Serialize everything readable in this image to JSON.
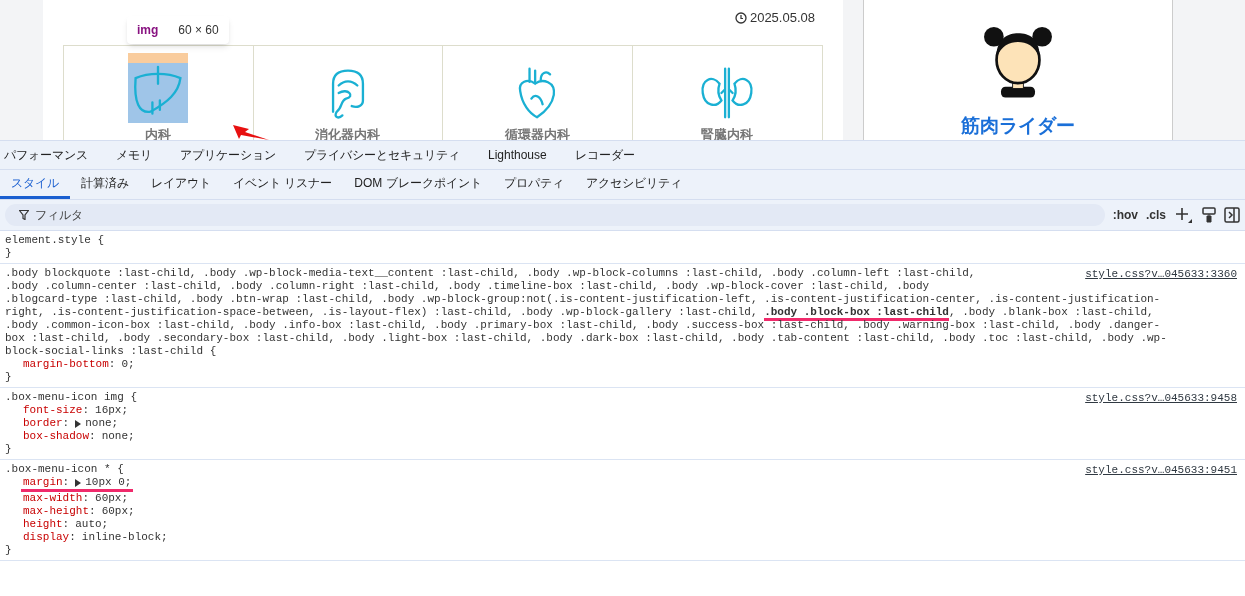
{
  "page": {
    "date": "2025.05.08",
    "tooltip": {
      "tag": "img",
      "size": "60 × 60"
    },
    "menu_items": [
      {
        "label": "内科",
        "kind": "liver",
        "highlighted": true
      },
      {
        "label": "消化器内科",
        "kind": "intestine",
        "highlighted": false
      },
      {
        "label": "循環器内科",
        "kind": "heart",
        "highlighted": false
      },
      {
        "label": "腎臓内科",
        "kind": "kidney",
        "highlighted": false
      }
    ],
    "profile": {
      "name": "筋肉ライダー"
    }
  },
  "devtools": {
    "panels": [
      "パフォーマンス",
      "メモリ",
      "アプリケーション",
      "プライバシーとセキュリティ",
      "Lighthouse",
      "レコーダー"
    ],
    "tabs": [
      {
        "label": "スタイル",
        "selected": true
      },
      {
        "label": "計算済み",
        "selected": false
      },
      {
        "label": "レイアウト",
        "selected": false
      },
      {
        "label": "イベント リスナー",
        "selected": false
      },
      {
        "label": "DOM ブレークポイント",
        "selected": false
      },
      {
        "label": "プロパティ",
        "selected": false
      },
      {
        "label": "アクセシビリティ",
        "selected": false
      }
    ],
    "filter": {
      "placeholder": "フィルタ"
    },
    "toolbar": {
      "hov": ":hov",
      "cls": ".cls"
    },
    "rules": [
      {
        "selector_lines": [
          "element.style {"
        ],
        "close": "}"
      },
      {
        "source": "style.css?v…045633:3360",
        "selector_lines": [
          ".body blockquote :last-child, .body .wp-block-media-text__content :last-child, .body .wp-block-columns :last-child, .body .column-left :last-child,",
          ".body .column-center :last-child, .body .column-right :last-child, .body .timeline-box :last-child, .body .wp-block-cover :last-child, .body",
          ".blogcard-type :last-child, .body .btn-wrap :last-child, .body .wp-block-group:not(.is-content-justification-left, .is-content-justification-center, .is-content-justification-",
          "right, .is-content-justification-space-between, .is-layout-flex) :last-child, .body .wp-block-gallery :last-child, **.body .block-box :last-child**, .body .blank-box :last-child,",
          ".body .common-icon-box :last-child, .body .info-box :last-child, .body .primary-box :last-child, .body .success-box :last-child, .body .warning-box :last-child, .body .danger-",
          "box :last-child, .body .secondary-box :last-child, .body .light-box :last-child, .body .dark-box :last-child, .body .tab-content :last-child, .body .toc :last-child, .body .wp-",
          "block-social-links :last-child {"
        ],
        "properties": [
          {
            "name": "margin-bottom",
            "colon": ":",
            "value": "0;",
            "expandable": false
          }
        ],
        "close": "}"
      },
      {
        "source": "style.css?v…045633:9458",
        "selector_lines": [
          ".box-menu-icon img {"
        ],
        "properties": [
          {
            "name": "font-size",
            "colon": ":",
            "value": "16px;",
            "expandable": false
          },
          {
            "name": "border",
            "colon": ":",
            "value": "none;",
            "expandable": true
          },
          {
            "name": "box-shadow",
            "colon": ":",
            "value": "none;",
            "expandable": false
          }
        ],
        "close": "}"
      },
      {
        "source": "style.css?v…045633:9451",
        "selector_lines": [
          ".box-menu-icon * {"
        ],
        "properties": [
          {
            "name": "margin",
            "colon": ":",
            "value": "10px 0;",
            "expandable": true,
            "annotated": true
          },
          {
            "name": "max-width",
            "colon": ":",
            "value": "60px;",
            "expandable": false
          },
          {
            "name": "max-height",
            "colon": ":",
            "value": "60px;",
            "expandable": false
          },
          {
            "name": "height",
            "colon": ":",
            "value": "auto;",
            "expandable": false
          },
          {
            "name": "display",
            "colon": ":",
            "value": "inline-block;",
            "expandable": false
          }
        ],
        "close": "}"
      }
    ]
  }
}
